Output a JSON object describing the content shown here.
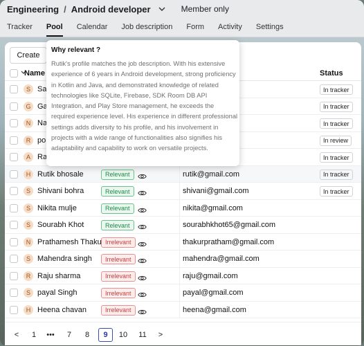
{
  "header": {
    "team": "Engineering",
    "separator": "/",
    "role": "Android developer",
    "membership": "Member only"
  },
  "tabs": [
    {
      "label": "Tracker"
    },
    {
      "label": "Pool",
      "active": true
    },
    {
      "label": "Calendar"
    },
    {
      "label": "Job description"
    },
    {
      "label": "Form"
    },
    {
      "label": "Activity"
    },
    {
      "label": "Settings"
    }
  ],
  "toolbar": {
    "create_label": "Create"
  },
  "table": {
    "col_name": "Name",
    "col_status": "Status",
    "rows": [
      {
        "initial": "S",
        "name": "Sal",
        "relevance": "",
        "email": "",
        "status": "In tracker"
      },
      {
        "initial": "G",
        "name": "Ga",
        "relevance": "",
        "email": "m",
        "status": "In tracker"
      },
      {
        "initial": "N",
        "name": "Na",
        "relevance": "",
        "email": "com",
        "status": "In tracker"
      },
      {
        "initial": "R",
        "name": "po",
        "relevance": "",
        "email": "",
        "status": "In review"
      },
      {
        "initial": "A",
        "name": "Ra",
        "relevance": "",
        "email": "",
        "status": "In tracker"
      },
      {
        "initial": "H",
        "name": "Rutik bhosale",
        "relevance": "Relevant",
        "email": "rutik@gmail.com",
        "status": "In tracker"
      },
      {
        "initial": "S",
        "name": "Shivani bohra",
        "relevance": "Relevant",
        "email": "shivani@gmail.com",
        "status": "In tracker"
      },
      {
        "initial": "S",
        "name": "Nikita mulje",
        "relevance": "Relevant",
        "email": "nikita@gmail.com",
        "status": ""
      },
      {
        "initial": "S",
        "name": "Sourabh Khot",
        "relevance": "Relevant",
        "email": "sourabhkhot65@gmail.com",
        "status": ""
      },
      {
        "initial": "N",
        "name": "Prathamesh Thakur",
        "relevance": "Irrelevant",
        "email": "thakurpratham@gmail.com",
        "status": ""
      },
      {
        "initial": "S",
        "name": "Mahendra singh",
        "relevance": "Irrelevant",
        "email": "mahendra@gmail.com",
        "status": ""
      },
      {
        "initial": "R",
        "name": "Raju sharma",
        "relevance": "Irrelevant",
        "email": "raju@gmail.com",
        "status": ""
      },
      {
        "initial": "S",
        "name": "payal Singh",
        "relevance": "Irrelevant",
        "email": "payal@gmail.com",
        "status": ""
      },
      {
        "initial": "H",
        "name": "Heena chavan",
        "relevance": "Irrelevant",
        "email": "heena@gmail.com",
        "status": ""
      }
    ]
  },
  "pagination": {
    "prev": "<",
    "pages": [
      "1",
      "•••",
      "7",
      "8",
      "9",
      "10",
      "11"
    ],
    "current": "9",
    "next": ">"
  },
  "tooltip": {
    "title": "Why relevant ?",
    "body": "Rutik's profile matches the job description. With his extensive experience of 6 years in Android development, strong proficiency in Kotlin and Java, and demonstrated knowledge of related technologies like SQLite, Firebase, SDK Room DB API Integration, and Play Store management, he exceeds the required experience level. His experience in different professional settings adds diversity to his profile, and his involvement in projects with a wide range of functionalities also signifies his adaptability and capability to work on versatile projects."
  },
  "icons": {
    "dropdown": "chevron-down-icon",
    "view": "eye-icon",
    "sort": "chevron-down-icon"
  },
  "colors": {
    "relevant": "#1f8a4a",
    "irrelevant": "#cc3b3b",
    "accent": "#2b3ba5"
  }
}
